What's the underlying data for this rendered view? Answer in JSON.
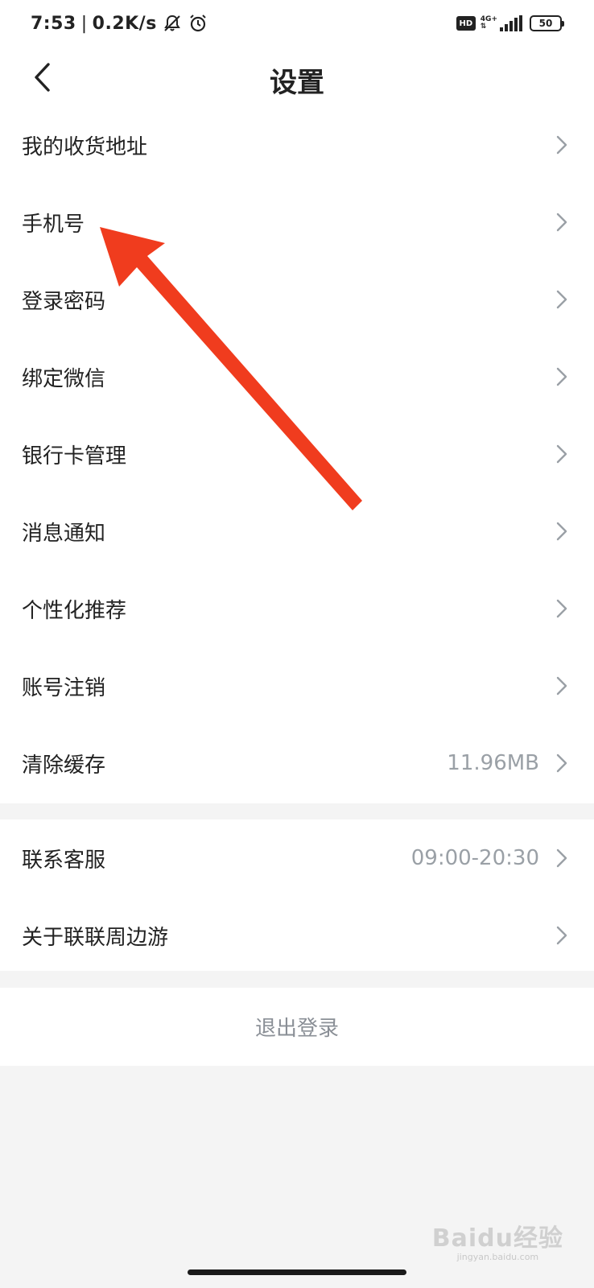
{
  "status_bar": {
    "time": "7:53",
    "separator": "|",
    "net_speed": "0.2K/s",
    "hd_label": "HD",
    "network_type": "4G+",
    "battery_level": "50",
    "icons": [
      "notifications-off-icon",
      "alarm-icon",
      "signal-icon",
      "battery-icon"
    ]
  },
  "header": {
    "title": "设置",
    "back_icon": "chevron-left-icon"
  },
  "settings_group_1": [
    {
      "label": "我的收货地址",
      "value": ""
    },
    {
      "label": "手机号",
      "value": ""
    },
    {
      "label": "登录密码",
      "value": ""
    },
    {
      "label": "绑定微信",
      "value": ""
    },
    {
      "label": "银行卡管理",
      "value": ""
    },
    {
      "label": "消息通知",
      "value": ""
    },
    {
      "label": "个性化推荐",
      "value": ""
    },
    {
      "label": "账号注销",
      "value": ""
    },
    {
      "label": "清除缓存",
      "value": "11.96MB"
    }
  ],
  "settings_group_2": [
    {
      "label": "联系客服",
      "value": "09:00-20:30"
    },
    {
      "label": "关于联联周边游",
      "value": ""
    }
  ],
  "logout_label": "退出登录",
  "watermark": {
    "main": "Baidu经验",
    "sub": "jingyan.baidu.com"
  },
  "colors": {
    "background": "#f4f4f4",
    "card": "#ffffff",
    "text_primary": "#222222",
    "text_secondary": "#9aa0a6",
    "arrow_annotation": "#f03c1e"
  }
}
